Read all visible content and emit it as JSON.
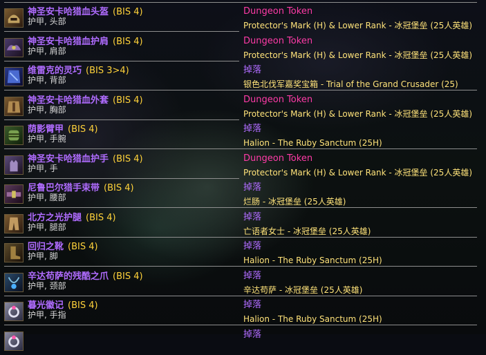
{
  "colors": {
    "item_name": "#b06cff",
    "bis": "#ffd23a",
    "slot": "#d6d6d6",
    "source": "#ff3ba7",
    "detail": "#ffe37a",
    "separator": "#8f8f8f"
  },
  "items": [
    {
      "name": "神圣安卡哈猎血头盔",
      "bis": "(BIS 4)",
      "slot": "护甲, 头部",
      "source": "Dungeon Token",
      "detail": "Protector's Mark (H) & Lower Rank - 冰冠堡垒 (25人英雄)",
      "icon": "helmet-icon"
    },
    {
      "name": "神圣安卡哈猎血护肩",
      "bis": "(BIS 4)",
      "slot": "护甲, 肩部",
      "source": "Dungeon Token",
      "detail": "Protector's Mark (H) & Lower Rank - 冰冠堡垒 (25人英雄)",
      "icon": "shoulders-icon"
    },
    {
      "name": "维雷克的灵巧",
      "bis": "(BIS 3>4)",
      "slot": "护甲, 背部",
      "source": "掉落",
      "detail": "银色北伐军嘉奖宝箱 - Trial of the Grand Crusader (25)",
      "icon": "cloak-icon"
    },
    {
      "name": "神圣安卡哈猎血外套",
      "bis": "(BIS 4)",
      "slot": "护甲, 胸部",
      "source": "Dungeon Token",
      "detail": "Protector's Mark (H) & Lower Rank - 冰冠堡垒 (25人英雄)",
      "icon": "chest-icon"
    },
    {
      "name": "荫影臂甲",
      "bis": "(BIS 4)",
      "slot": "护甲, 手腕",
      "source": "掉落",
      "detail": "Halion - The Ruby Sanctum (25H)",
      "icon": "bracers-icon"
    },
    {
      "name": "神圣安卡哈猎血护手",
      "bis": "(BIS 4)",
      "slot": "护甲, 手",
      "source": "Dungeon Token",
      "detail": "Protector's Mark (H) & Lower Rank - 冰冠堡垒 (25人英雄)",
      "icon": "gloves-icon"
    },
    {
      "name": "尼鲁巴尔猎手束带",
      "bis": "(BIS 4)",
      "slot": "护甲, 腰部",
      "source": "掉落",
      "detail": "烂肠 - 冰冠堡垒 (25人英雄)",
      "icon": "belt-icon"
    },
    {
      "name": "北方之光护腿",
      "bis": "(BIS 4)",
      "slot": "护甲, 腿部",
      "source": "掉落",
      "detail": "亡语者女士 - 冰冠堡垒 (25人英雄)",
      "icon": "legs-icon"
    },
    {
      "name": "回归之靴",
      "bis": "(BIS 4)",
      "slot": "护甲, 脚",
      "source": "掉落",
      "detail": "Halion - The Ruby Sanctum (25H)",
      "icon": "boots-icon"
    },
    {
      "name": "辛达苟萨的残酷之爪",
      "bis": "(BIS 4)",
      "slot": "护甲, 颈部",
      "source": "掉落",
      "detail": "辛达苟萨 - 冰冠堡垒 (25人英雄)",
      "icon": "necklace-icon"
    },
    {
      "name": "暮光徽记",
      "bis": "(BIS 4)",
      "slot": "护甲, 手指",
      "source": "掉落",
      "detail": "Halion - The Ruby Sanctum (25H)",
      "icon": "ring-icon"
    },
    {
      "name": "",
      "bis": "",
      "slot": "",
      "source": "掉落",
      "detail": "",
      "icon": "ring-icon"
    }
  ]
}
